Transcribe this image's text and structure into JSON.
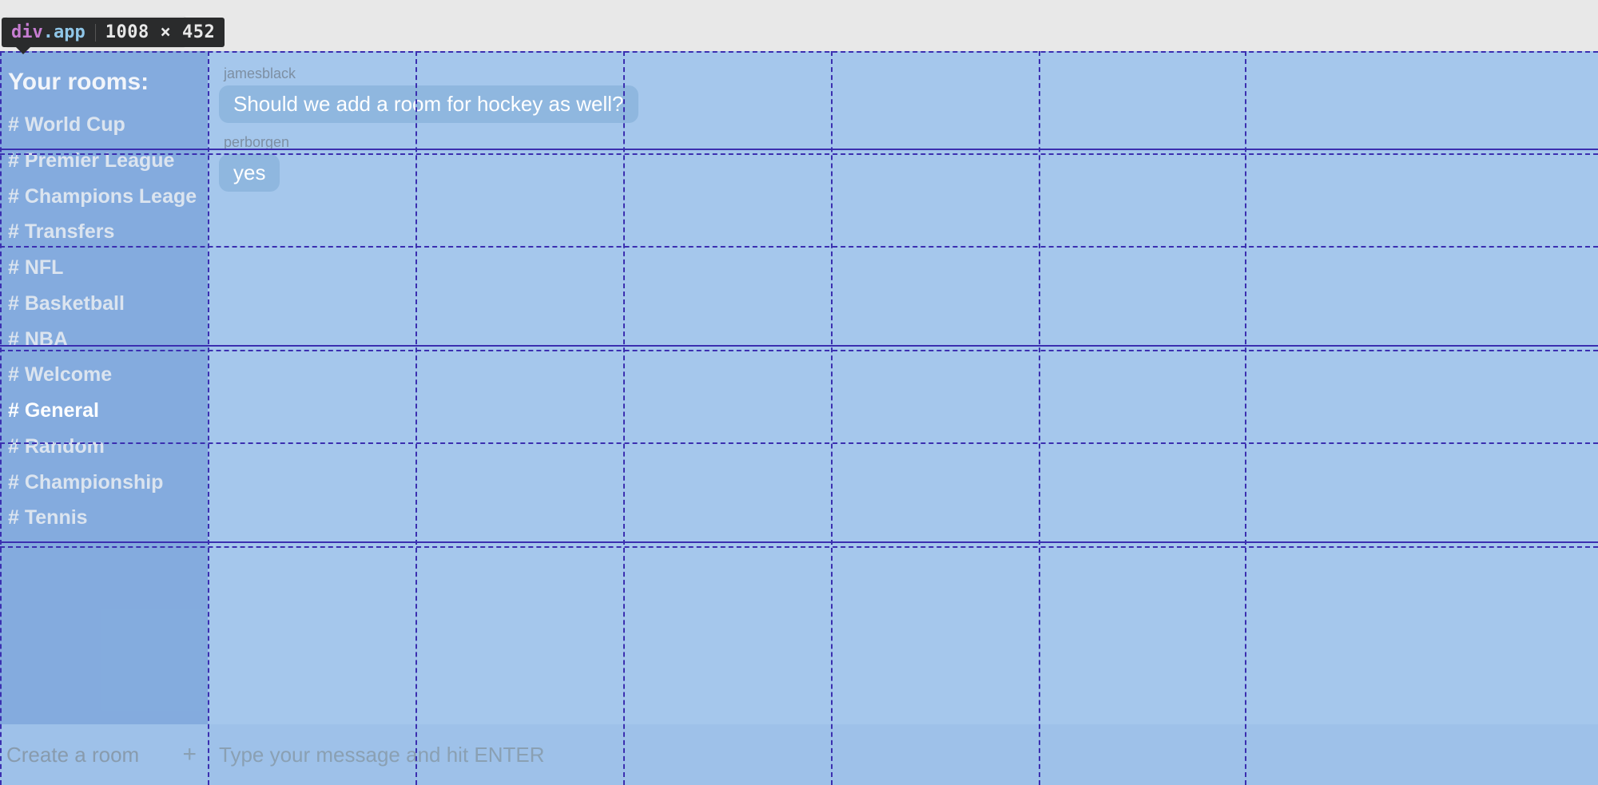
{
  "devtools": {
    "tag": "div",
    "class": ".app",
    "dimensions": "1008 × 452"
  },
  "url": "dex.html#",
  "sidebar": {
    "title": "Your rooms:",
    "rooms": [
      "# World Cup",
      "# Premier League",
      "# Champions Leage",
      "# Transfers",
      "# NFL",
      "# Basketball",
      "# NBA",
      "# Welcome",
      "# General",
      "# Random",
      "# Championship",
      "# Tennis"
    ],
    "active_index": 8
  },
  "messages": [
    {
      "sender": "jamesblack",
      "text": "Should we add a room for hockey as well?"
    },
    {
      "sender": "perborgen",
      "text": "yes"
    }
  ],
  "footer": {
    "create_room": "Create a room",
    "plus": "+",
    "placeholder": "Type your message and hit ENTER"
  }
}
